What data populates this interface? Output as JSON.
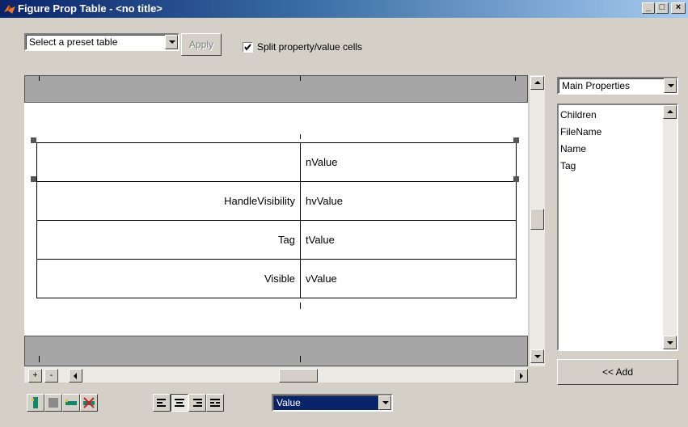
{
  "window": {
    "title": "Figure Prop Table - <no title>",
    "controls": [
      "_",
      "□",
      "×"
    ]
  },
  "toolbar": {
    "preset_combo_value": "Select a preset table",
    "apply_label": "Apply",
    "split_checkbox_label": "Split property/value cells",
    "split_checked": true
  },
  "table": {
    "rows": [
      {
        "property": "",
        "value": "nValue"
      },
      {
        "property": "HandleVisibility",
        "value": "hvValue"
      },
      {
        "property": "Tag",
        "value": "tValue"
      },
      {
        "property": "Visible",
        "value": "vValue"
      }
    ]
  },
  "right_panel": {
    "category_combo_value": "Main Properties",
    "properties": [
      "Children",
      "FileName",
      "Name",
      "Tag"
    ],
    "add_button_label": "<< Add"
  },
  "bottom": {
    "zoom_in_label": "+",
    "zoom_out_label": "-",
    "value_combo_value": "Value",
    "tools": [
      {
        "icon": "insert-column-icon"
      },
      {
        "icon": "merge-cells-icon"
      },
      {
        "icon": "insert-row-icon"
      },
      {
        "icon": "delete-cells-icon"
      },
      {
        "icon": "align-left-icon"
      },
      {
        "icon": "align-center-icon"
      },
      {
        "icon": "align-right-icon"
      },
      {
        "icon": "justify-icon"
      }
    ]
  },
  "colors": {
    "title_gradient_start": "#0a246a",
    "title_gradient_end": "#a6caf0",
    "face": "#d4d0c8",
    "selection": "#0a246a"
  }
}
